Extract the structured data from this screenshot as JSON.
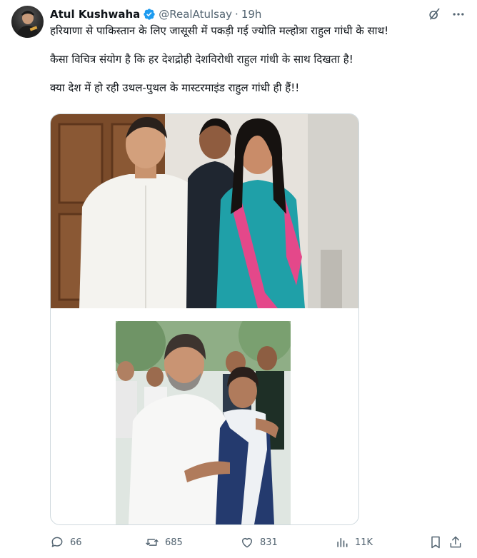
{
  "tweet": {
    "author_name": "Atul Kushwaha",
    "handle": "@RealAtulsay",
    "separator": "·",
    "time": "19h",
    "paragraphs": [
      "हरियाणा से पाकिस्तान के लिए जासूसी में पकड़ी गई ज्योति मल्होत्रा राहुल गांधी के साथ!",
      "कैसा विचित्र संयोग है कि हर देशद्रोही देशविरोधी राहुल गांधी के साथ दिखता है!",
      "क्या देश में हो रही उथल-पुथल के मास्टरमाइंड राहुल गांधी ही हैं!!"
    ]
  },
  "icons": {
    "verified": "verified-badge-icon",
    "grok": "grok-icon",
    "more": "more-icon",
    "reply": "reply-icon",
    "retweet": "retweet-icon",
    "like": "like-icon",
    "views": "views-icon",
    "bookmark": "bookmark-icon",
    "share": "share-icon"
  },
  "actions": {
    "replies": "66",
    "retweets": "685",
    "likes": "831",
    "views": "11K"
  },
  "colors": {
    "accent": "#1d9bf0",
    "text": "#0f1419",
    "muted": "#536471",
    "border": "#cfd9de"
  }
}
